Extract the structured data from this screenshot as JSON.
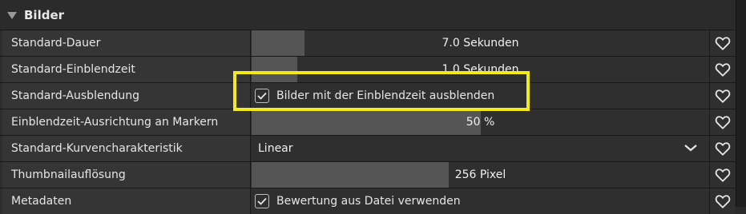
{
  "section": {
    "title": "Bilder",
    "collapse_icon": "triangle-down-icon"
  },
  "rows": [
    {
      "label": "Standard-Dauer",
      "type": "slider",
      "value": "7.0 Sekunden",
      "fill_fraction": 0.115
    },
    {
      "label": "Standard-Einblendzeit",
      "type": "slider",
      "value": "1.0 Sekunden",
      "fill_fraction": 0.1
    },
    {
      "label": "Standard-Ausblendung",
      "type": "checkbox",
      "value": "Bilder mit der Einblendzeit ausblenden",
      "checked": true
    },
    {
      "label": "Einblendzeit-Ausrichtung an Markern",
      "type": "slider",
      "value": "50 %",
      "fill_fraction": 0.5
    },
    {
      "label": "Standard-Kurvencharakteristik",
      "type": "dropdown",
      "value": "Linear"
    },
    {
      "label": "Thumbnailauflösung",
      "type": "slider",
      "value": "256 Pixel",
      "fill_fraction": 0.43
    },
    {
      "label": "Metadaten",
      "type": "checkbox",
      "value": "Bewertung aus Datei verwenden",
      "checked": true
    }
  ],
  "favorite_icon": "heart-outline-icon",
  "colors": {
    "highlight": "#f2ea1c",
    "slider_fill": "#555555",
    "background": "#2a2a2a"
  }
}
